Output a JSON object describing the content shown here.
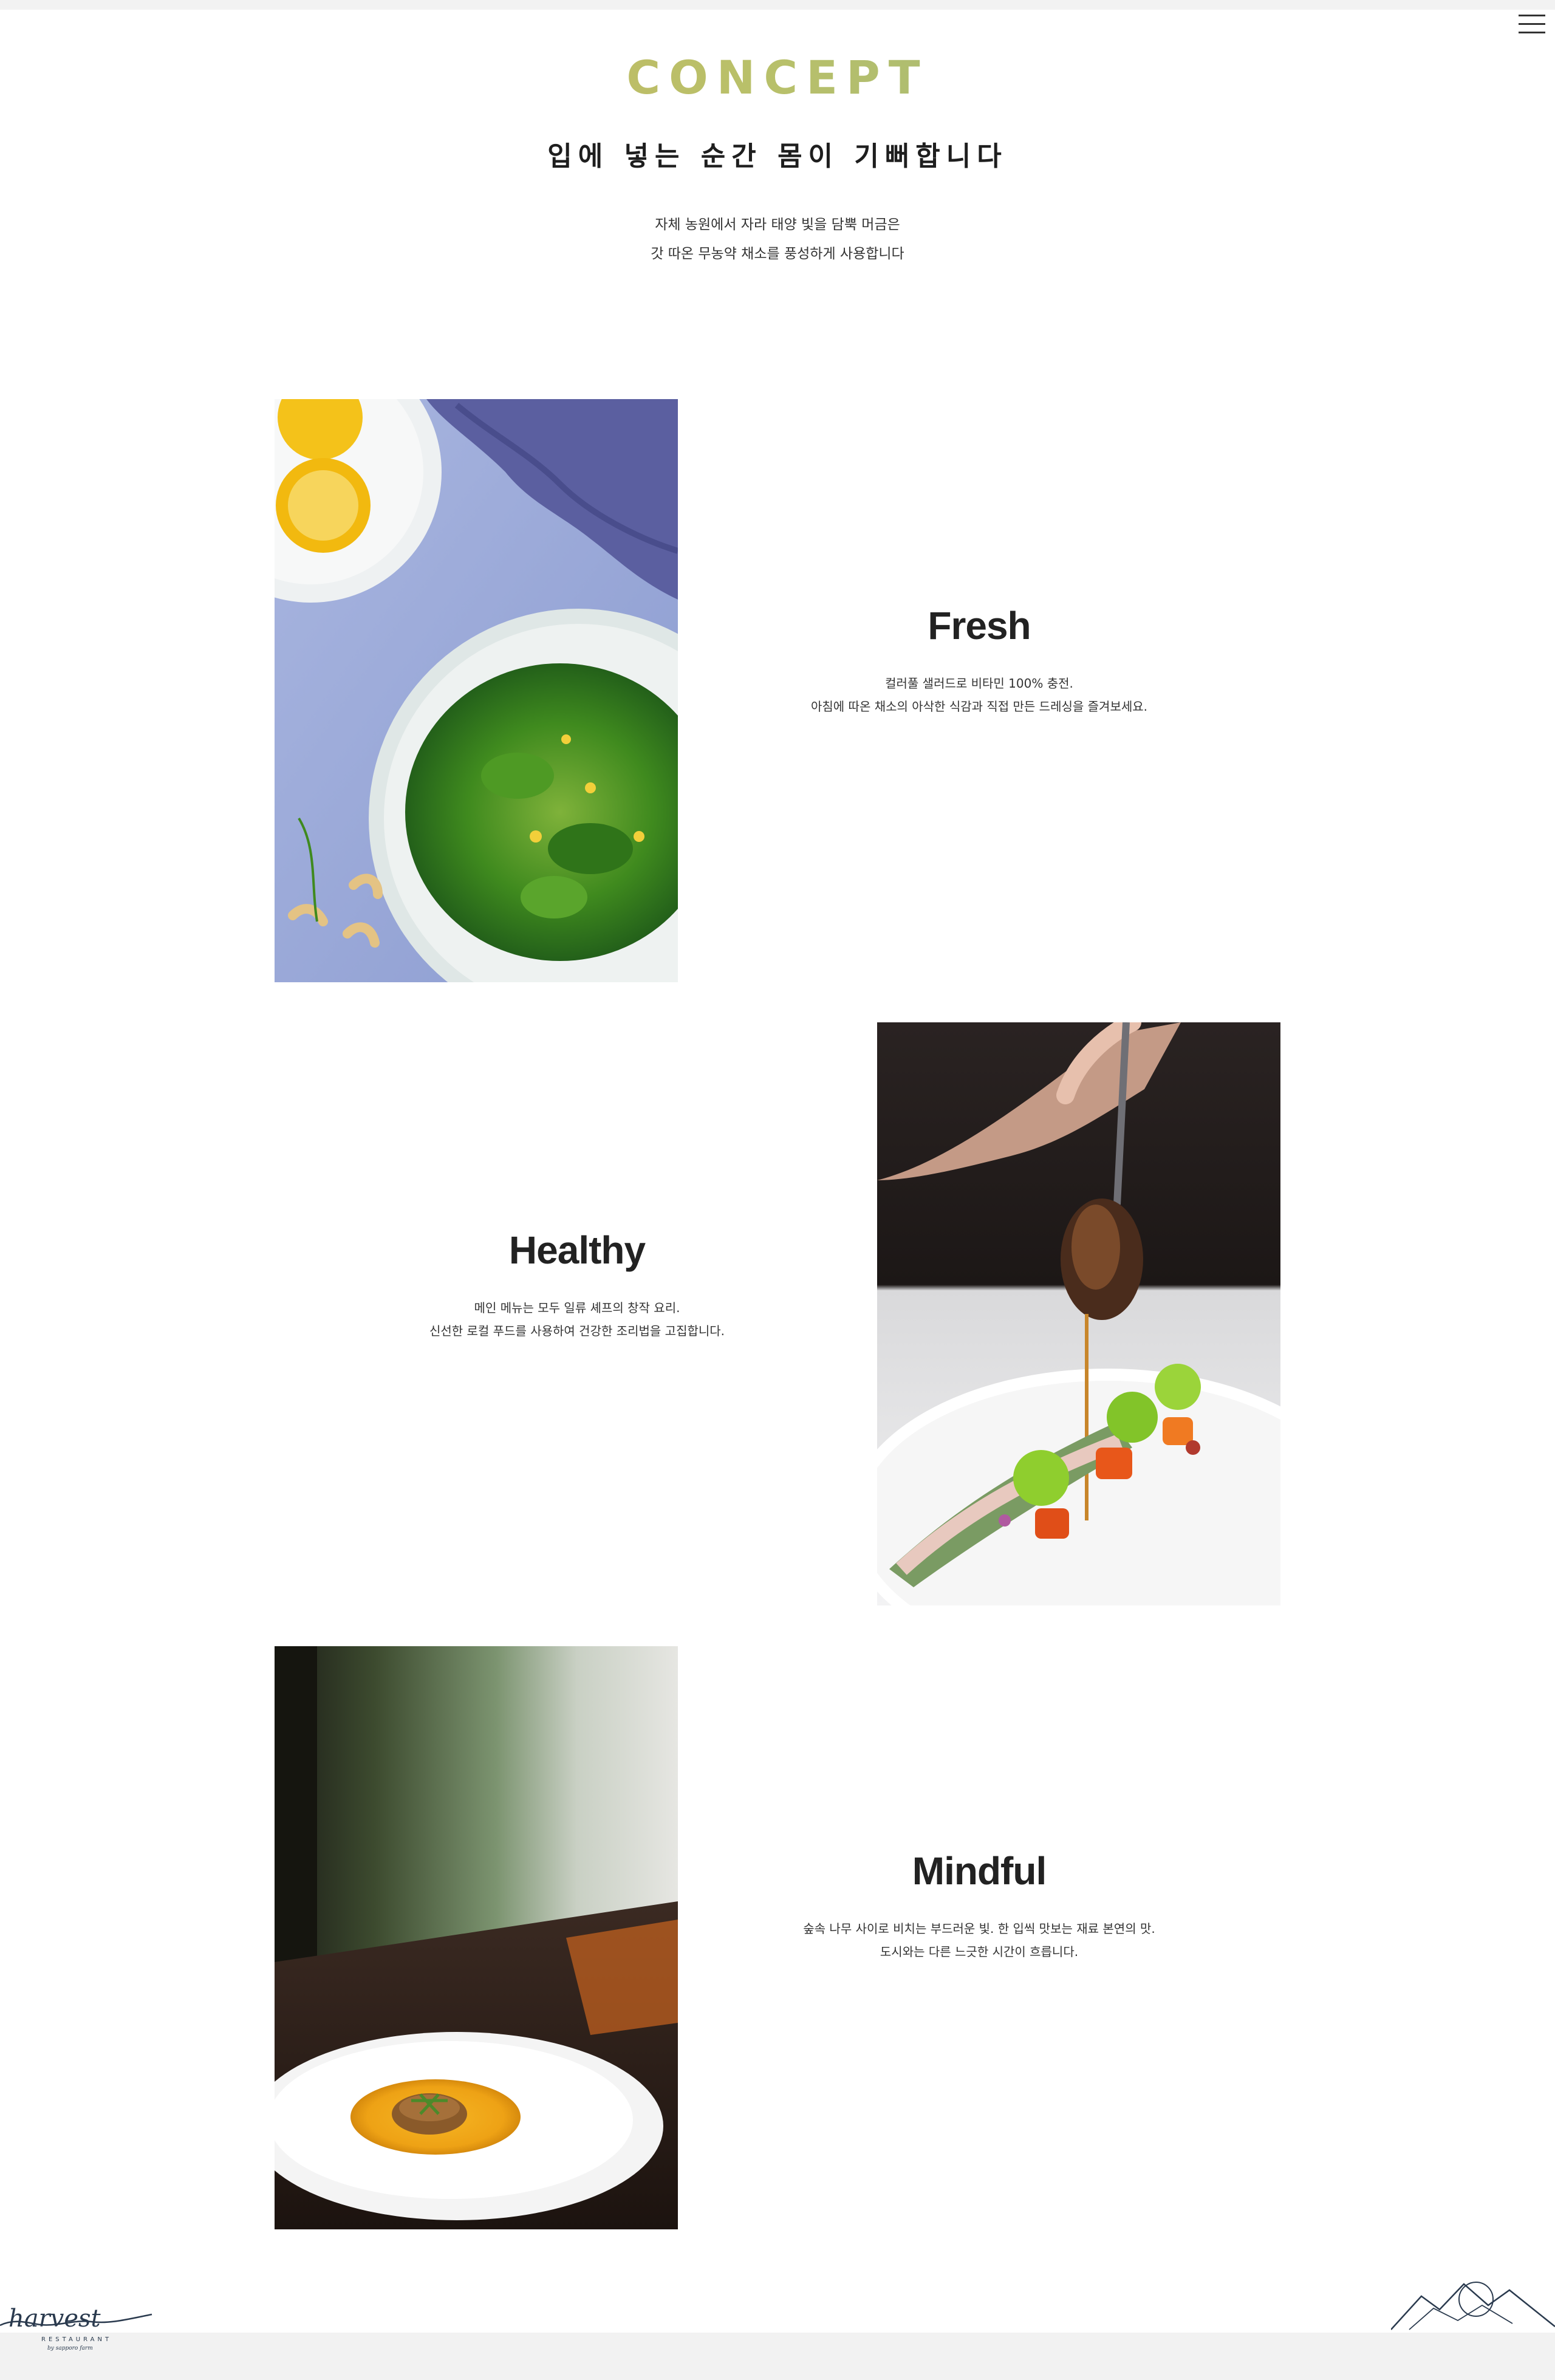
{
  "header": {
    "title": "CONCEPT",
    "subtitle": "입에 넣는 순간 몸이 기뻐합니다",
    "description": [
      "자체 농원에서 자라 태양 빛을 담뿍 머금은",
      "갓 따온 무농약 채소를 풍성하게 사용합니다"
    ]
  },
  "menu": {
    "icon": "hamburger-menu-icon"
  },
  "features": [
    {
      "title": "Fresh",
      "lines": [
        "컬러풀 샐러드로 비타민 100% 충전.",
        "아침에 따온 채소의 아삭한 식감과 직접 만든 드레싱을 즐겨보세요."
      ],
      "image": "green-salad-photo"
    },
    {
      "title": "Healthy",
      "lines": [
        "메인 메뉴는 모두 일류 셰프의 창작 요리.",
        "신선한 로컬 푸드를 사용하여 건강한 조리법을 고집합니다."
      ],
      "image": "plated-dish-with-sauce-photo"
    },
    {
      "title": "Mindful",
      "lines": [
        "숲속 나무 사이로 비치는 부드러운 빛. 한 입씩 맛보는 재료 본연의 맛.",
        "도시와는 다른 느긋한 시간이 흐릅니다."
      ],
      "image": "soup-bowl-photo"
    }
  ],
  "footer": {
    "logo_script": "harvest",
    "logo_sub": "RESTAURANT",
    "logo_tag": "by sapporo farm",
    "mountain_icon": "mountain-sun-icon"
  },
  "colors": {
    "title_gradient_start": "#d1b65a",
    "title_gradient_end": "#88b08a",
    "text": "#222222",
    "strip": "#f2f2f2"
  }
}
